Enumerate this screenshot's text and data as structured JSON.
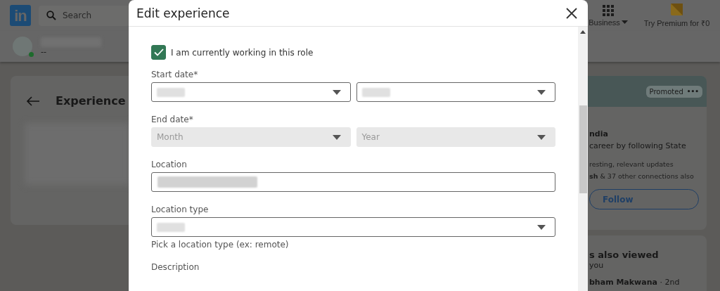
{
  "nav": {
    "logo": "in",
    "search": {
      "placeholder": "Search"
    },
    "items": [
      {
        "kind": "apps",
        "label": "Business"
      },
      {
        "kind": "premium",
        "label": "Try Premium for ₹0"
      }
    ]
  },
  "profile_bar": {
    "name_redacted": true,
    "subtitle": "--",
    "online": true
  },
  "experience_card": {
    "title": "Experience",
    "content_redacted": true
  },
  "ad_card": {
    "badge": "Promoted",
    "menu": "•••",
    "title": "ndia",
    "text": "career by following State",
    "note_1": "resting, relevant updates",
    "note_2": "**sh** & 37 other connections also",
    "button": "Follow"
  },
  "also_viewed": {
    "title": "s also viewed",
    "subtitle": "you",
    "person": "**bham Makwana** · 2nd"
  },
  "dialog": {
    "title": "Edit experience",
    "currently_working": {
      "label": "I am currently working in this role",
      "checked": true
    },
    "fields": [
      {
        "kind": "date",
        "label": "Start date*",
        "disabled": false,
        "selects": [
          {
            "redacted": true
          },
          {
            "redacted": true
          }
        ]
      },
      {
        "kind": "date",
        "label": "End date*",
        "disabled": true,
        "selects": [
          {
            "placeholder": "Month"
          },
          {
            "placeholder": "Year"
          }
        ]
      },
      {
        "kind": "text",
        "label": "Location",
        "redacted": true
      },
      {
        "kind": "select",
        "label": "Location type",
        "redacted": true,
        "hint": "Pick a location type (ex: remote)"
      },
      {
        "kind": "label",
        "label": "Description"
      }
    ]
  }
}
